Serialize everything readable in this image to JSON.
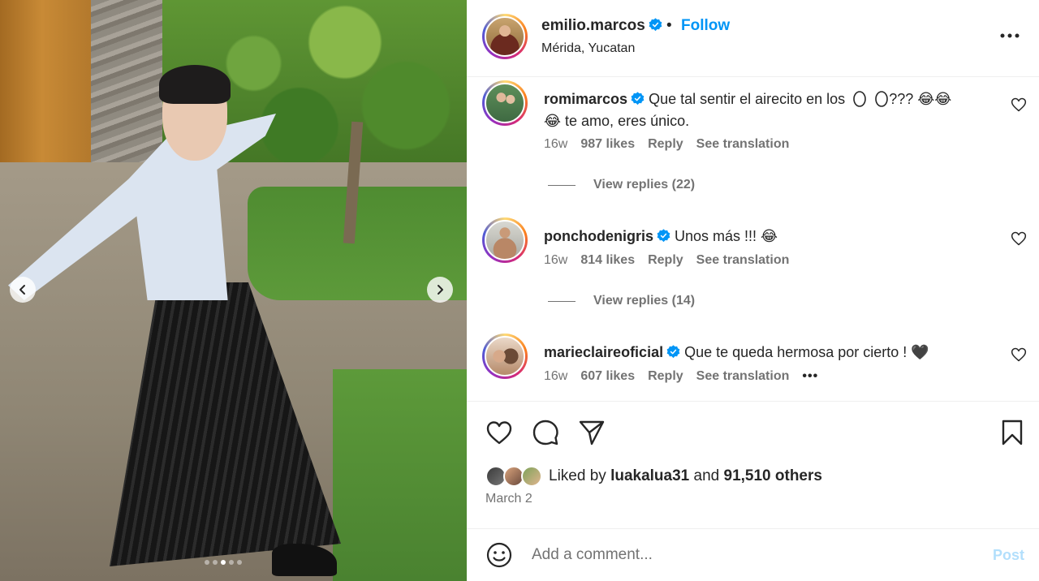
{
  "post": {
    "username": "emilio.marcos",
    "separator": "•",
    "follow_label": "Follow",
    "location": "Mérida, Yucatan",
    "more_icon": "more-horizontal-icon"
  },
  "carousel": {
    "total_slides": 5,
    "active_slide": 3
  },
  "comments": [
    {
      "username": "romimarcos",
      "text": "Que tal sentir el airecito en los",
      "text_tail": "??? 😂😂",
      "text_line2": "😂 te amo, eres único.",
      "age": "16w",
      "likes": "987 likes",
      "reply_label": "Reply",
      "translate_label": "See translation",
      "view_replies": "View replies (22)"
    },
    {
      "username": "ponchodenigris",
      "text": "Unos más !!! 😂",
      "age": "16w",
      "likes": "814 likes",
      "reply_label": "Reply",
      "translate_label": "See translation",
      "view_replies": "View replies (14)"
    },
    {
      "username": "marieclaireoficial",
      "text": "Que te queda hermosa por cierto ! 🖤",
      "age": "16w",
      "likes": "607 likes",
      "reply_label": "Reply",
      "translate_label": "See translation",
      "more": "•••"
    }
  ],
  "likes": {
    "prefix": "Liked by",
    "user": "luakalua31",
    "conjunction": "and",
    "others": "91,510 others"
  },
  "date": "March 2",
  "composer": {
    "placeholder": "Add a comment...",
    "post_label": "Post"
  },
  "colors": {
    "accent": "#0095f6",
    "text": "#262626",
    "muted": "#737373",
    "post_disabled": "#b2dffc",
    "border": "#efefef"
  }
}
